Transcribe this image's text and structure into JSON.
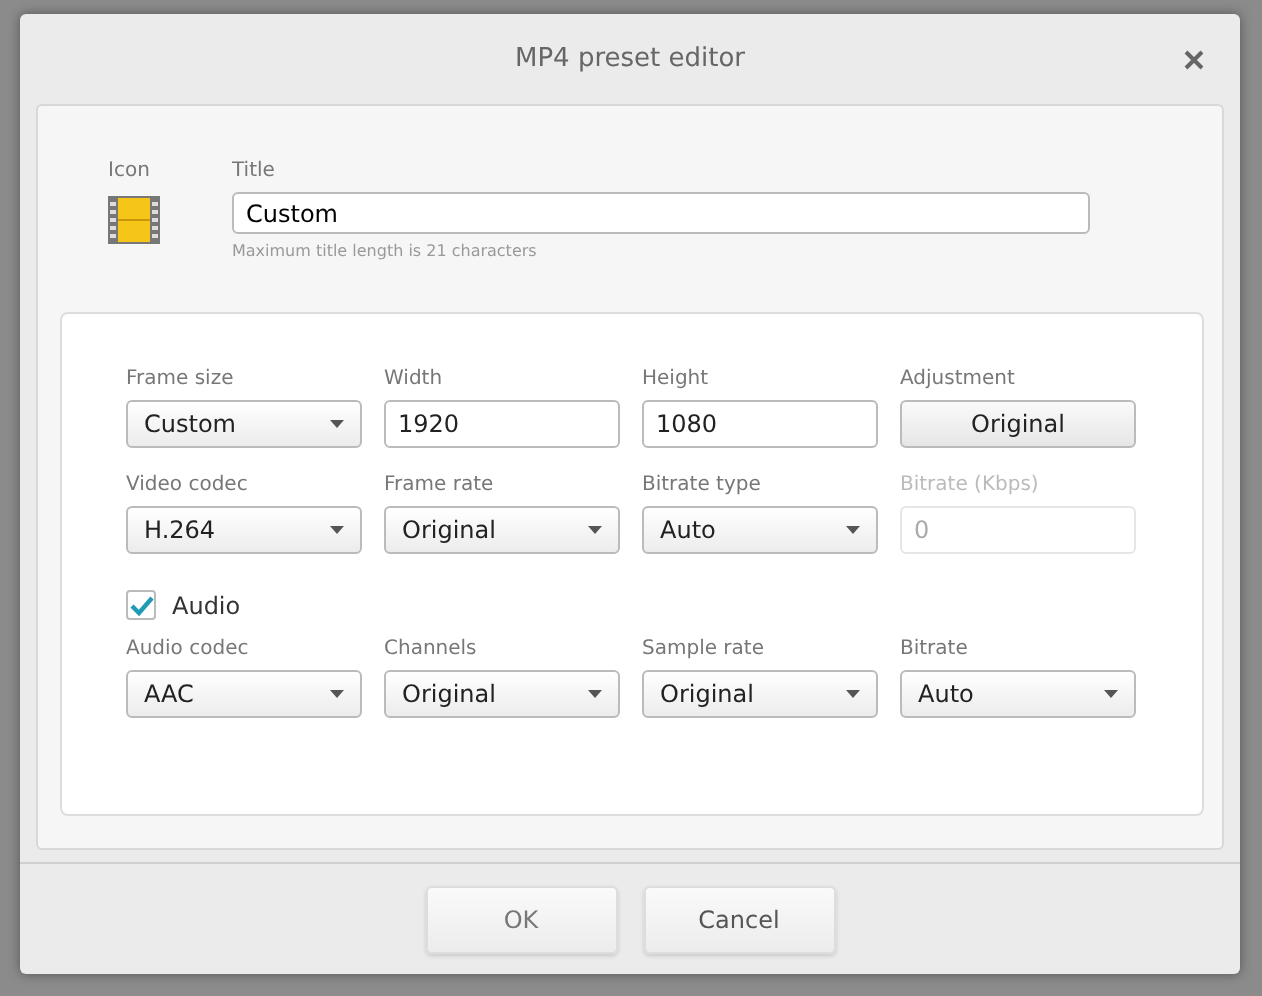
{
  "window": {
    "title": "MP4 preset editor"
  },
  "header": {
    "icon_label": "Icon",
    "title_label": "Title",
    "title_value": "Custom",
    "hint": "Maximum title length is 21 characters"
  },
  "video_rows": [
    [
      {
        "label": "Frame size",
        "kind": "select",
        "value": "Custom",
        "disabled": false
      },
      {
        "label": "Width",
        "kind": "input",
        "value": "1920",
        "disabled": false
      },
      {
        "label": "Height",
        "kind": "input",
        "value": "1080",
        "disabled": false
      },
      {
        "label": "Adjustment",
        "kind": "button",
        "value": "Original",
        "disabled": false
      }
    ],
    [
      {
        "label": "Video codec",
        "kind": "select",
        "value": "H.264",
        "disabled": false
      },
      {
        "label": "Frame rate",
        "kind": "select",
        "value": "Original",
        "disabled": false
      },
      {
        "label": "Bitrate type",
        "kind": "select",
        "value": "Auto",
        "disabled": false
      },
      {
        "label": "Bitrate (Kbps)",
        "kind": "input",
        "value": "0",
        "disabled": true
      }
    ]
  ],
  "audio": {
    "label": "Audio",
    "checked": true
  },
  "audio_rows": [
    [
      {
        "label": "Audio codec",
        "kind": "select",
        "value": "AAC",
        "disabled": false
      },
      {
        "label": "Channels",
        "kind": "select",
        "value": "Original",
        "disabled": false
      },
      {
        "label": "Sample rate",
        "kind": "select",
        "value": "Original",
        "disabled": false
      },
      {
        "label": "Bitrate",
        "kind": "select",
        "value": "Auto",
        "disabled": false
      }
    ]
  ],
  "buttons": [
    "OK",
    "Cancel"
  ]
}
